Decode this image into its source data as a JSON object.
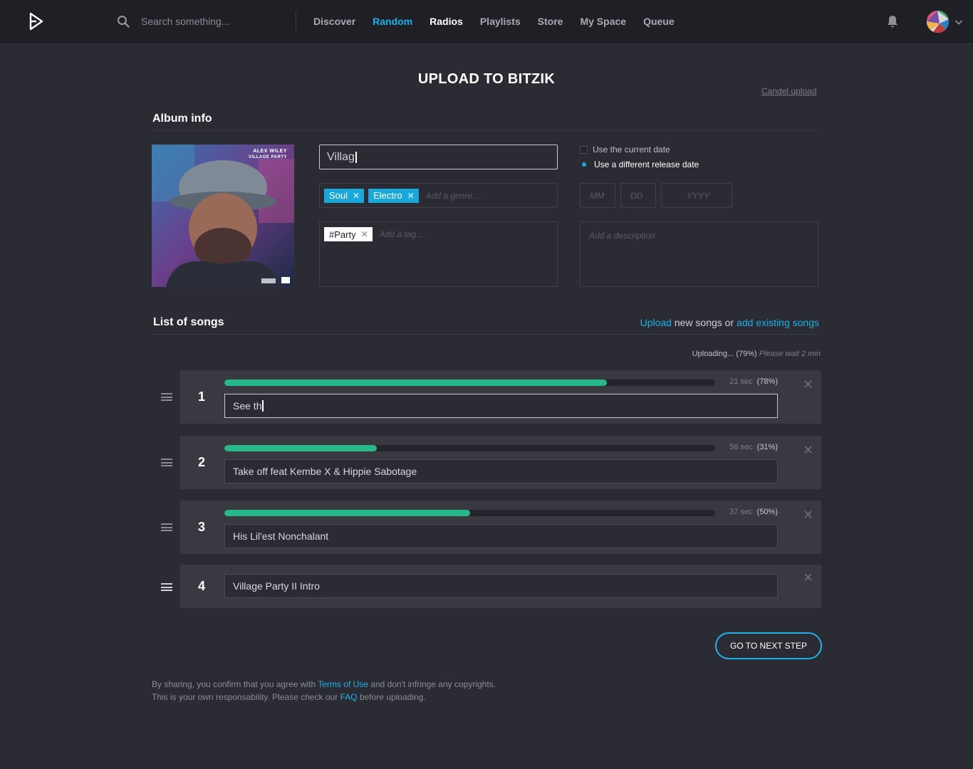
{
  "header": {
    "search_placeholder": "Search something...",
    "nav": [
      "Discover",
      "Random",
      "Radios",
      "Playlists",
      "Store",
      "My Space",
      "Queue"
    ],
    "active_nav": "Random",
    "icons": {
      "logo": "play-logo-icon",
      "search": "search-icon",
      "notifications": "bell-icon",
      "menu": "chevron-down-icon"
    }
  },
  "page": {
    "title": "UPLOAD TO BITZIK",
    "cancel_label": "Candel upload"
  },
  "album": {
    "section_title": "Album info",
    "cover_text": {
      "artist": "ALEX WILEY",
      "album": "VILLAGE PARTY"
    },
    "title_value": "Villag",
    "genres": [
      "Soul",
      "Electro"
    ],
    "genre_placeholder": "Add a genre ...",
    "tags": [
      "#Party"
    ],
    "tag_placeholder": "Add a tag ...",
    "date_options": [
      {
        "label": "Use the current date",
        "selected": false
      },
      {
        "label": "Use a different release date",
        "selected": true
      }
    ],
    "date_placeholders": {
      "month": "MM",
      "day": "DD",
      "year": "YYYY"
    },
    "description_placeholder": "Add a description"
  },
  "songs": {
    "section_title": "List of songs",
    "actions": {
      "upload": "Upload",
      "middle": "new songs or",
      "existing": "add existing songs"
    },
    "status": {
      "text": "Uploading... (79%)",
      "wait": "Please wait 2 min"
    },
    "items": [
      {
        "number": "1",
        "title": "See th",
        "time": "21 sec",
        "percent": "(78%)",
        "progress": 0.78,
        "focused": true
      },
      {
        "number": "2",
        "title": "Take off feat Kembe X & Hippie Sabotage",
        "time": "56 sec",
        "percent": "(31%)",
        "progress": 0.31,
        "focused": false
      },
      {
        "number": "3",
        "title": "His Lil'est Nonchalant",
        "time": "37 sec",
        "percent": "(50%)",
        "progress": 0.5,
        "focused": false
      },
      {
        "number": "4",
        "title": "Village Party II Intro",
        "focused": false
      }
    ]
  },
  "next_button": "GO TO NEXT STEP",
  "footer": {
    "line1_a": "By sharing, you confirm that you agree with",
    "terms": "Terms of Use",
    "line1_b": "and don't infringe any copyrights.",
    "line2_a": "This is your own responsability. Please check our",
    "faq": "FAQ",
    "line2_b": "before uploading."
  },
  "colors": {
    "accent": "#1cb0e8",
    "progress": "#27b88a",
    "background": "#2b2c33",
    "header": "#1f2026"
  }
}
